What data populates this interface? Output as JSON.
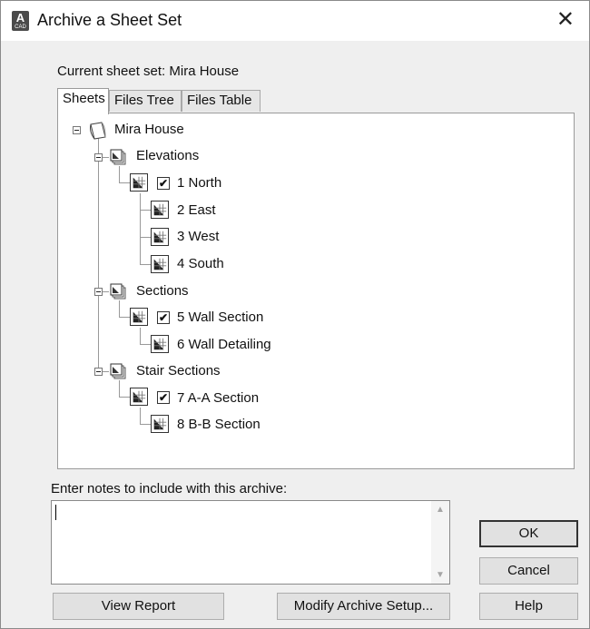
{
  "window": {
    "title": "Archive a Sheet Set",
    "close_symbol": "✕",
    "app_icon_letter": "A",
    "app_icon_sub": "CAD"
  },
  "current_sheet_set_label": "Current sheet set: Mira House",
  "tabs": [
    {
      "label": "Sheets",
      "active": true
    },
    {
      "label": "Files Tree",
      "active": false
    },
    {
      "label": "Files Table",
      "active": false
    }
  ],
  "tree": {
    "root": "Mira House",
    "subsets": [
      {
        "label": "Elevations",
        "sheets": [
          {
            "label": "1 North",
            "checked": true
          },
          {
            "label": "2 East",
            "checked": false
          },
          {
            "label": "3 West",
            "checked": false
          },
          {
            "label": "4 South",
            "checked": false
          }
        ]
      },
      {
        "label": "Sections",
        "sheets": [
          {
            "label": "5 Wall Section",
            "checked": true
          },
          {
            "label": "6 Wall Detailing",
            "checked": false
          }
        ]
      },
      {
        "label": "Stair Sections",
        "sheets": [
          {
            "label": "7 A-A Section",
            "checked": true
          },
          {
            "label": "8 B-B Section",
            "checked": false
          }
        ]
      }
    ]
  },
  "notes": {
    "label": "Enter notes to include with this archive:",
    "value": ""
  },
  "buttons": {
    "ok": "OK",
    "cancel": "Cancel",
    "help": "Help",
    "view_report": "View Report",
    "modify_setup": "Modify Archive Setup..."
  },
  "check_mark": "✔"
}
